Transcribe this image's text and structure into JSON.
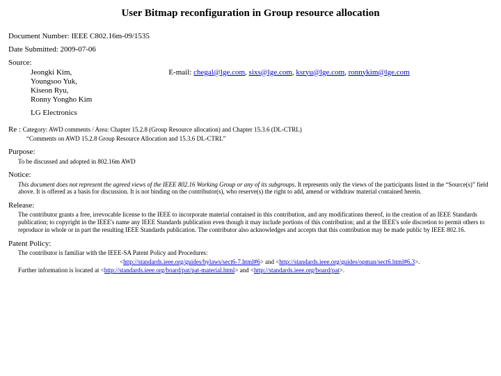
{
  "title": "User Bitmap reconfiguration in Group resource allocation",
  "doc_number_label": "Document Number: ",
  "doc_number": "IEEE C802.16m-09/1535",
  "date_label": "Date Submitted: ",
  "date": "2009-07-06",
  "source_label": "Source:",
  "authors": [
    "Jeongki Kim,",
    "Youngsoo Yuk,",
    "Kiseon Ryu,",
    "Ronny Yongho Kim"
  ],
  "email_label": "E-mail: ",
  "emails": [
    "chegal@lge.com",
    "sixs@lge.com",
    "ksryu@lge.com",
    "ronnykim@lge.com"
  ],
  "company": "LG Electronics",
  "re_label": "Re : ",
  "re_line1": "Category: AWD comments / Area: Chapter 15.2.8 (Group Resource allocation) and Chapter 15.3.6 (DL-CTRL)",
  "re_line2": "“Comments on AWD 15.2.8 Group Resource Allocation and 15.3.6 DL-CTRL”",
  "purpose_label": "Purpose:",
  "purpose_body": "To be discussed and adopted in 802.16m AWD",
  "notice_label": "Notice:",
  "notice_italic": "This document does not represent the agreed views of the IEEE 802.16 Working Group or any of its subgroups",
  "notice_rest": ". It represents only the views of the participants listed in the “Source(s)” field above. It is offered as a basis for discussion. It is not binding on the contributor(s), who reserve(s) the right to add, amend or withdraw material contained herein.",
  "release_label": "Release:",
  "release_body": "The contributor grants a free, irrevocable license to the IEEE to incorporate material contained in this contribution, and any modifications thereof, in the creation of an IEEE Standards publication; to copyright in the IEEE's name any IEEE Standards publication even though it may include portions of this contribution; and at the IEEE's sole discretion to permit others to reproduce in whole or in part the resulting IEEE Standards publication. The contributor also acknowledges and accepts that this contribution may be made public by IEEE 802.16.",
  "patent_label": "Patent Policy:",
  "patent_intro": "The contributor is familiar with the IEEE-SA Patent Policy and Procedures:",
  "patent_link1": "http://standards.ieee.org/guides/bylaws/sect6-7.html#6",
  "patent_link2": "http://standards.ieee.org/guides/opman/sect6.html#6.3",
  "patent_further": "Further information is located at <",
  "patent_link3": "http://standards.ieee.org/board/pat/pat-material.html",
  "patent_mid": "> and <",
  "patent_link4": "http://standards.ieee.org/board/pat",
  "patent_end": ">."
}
